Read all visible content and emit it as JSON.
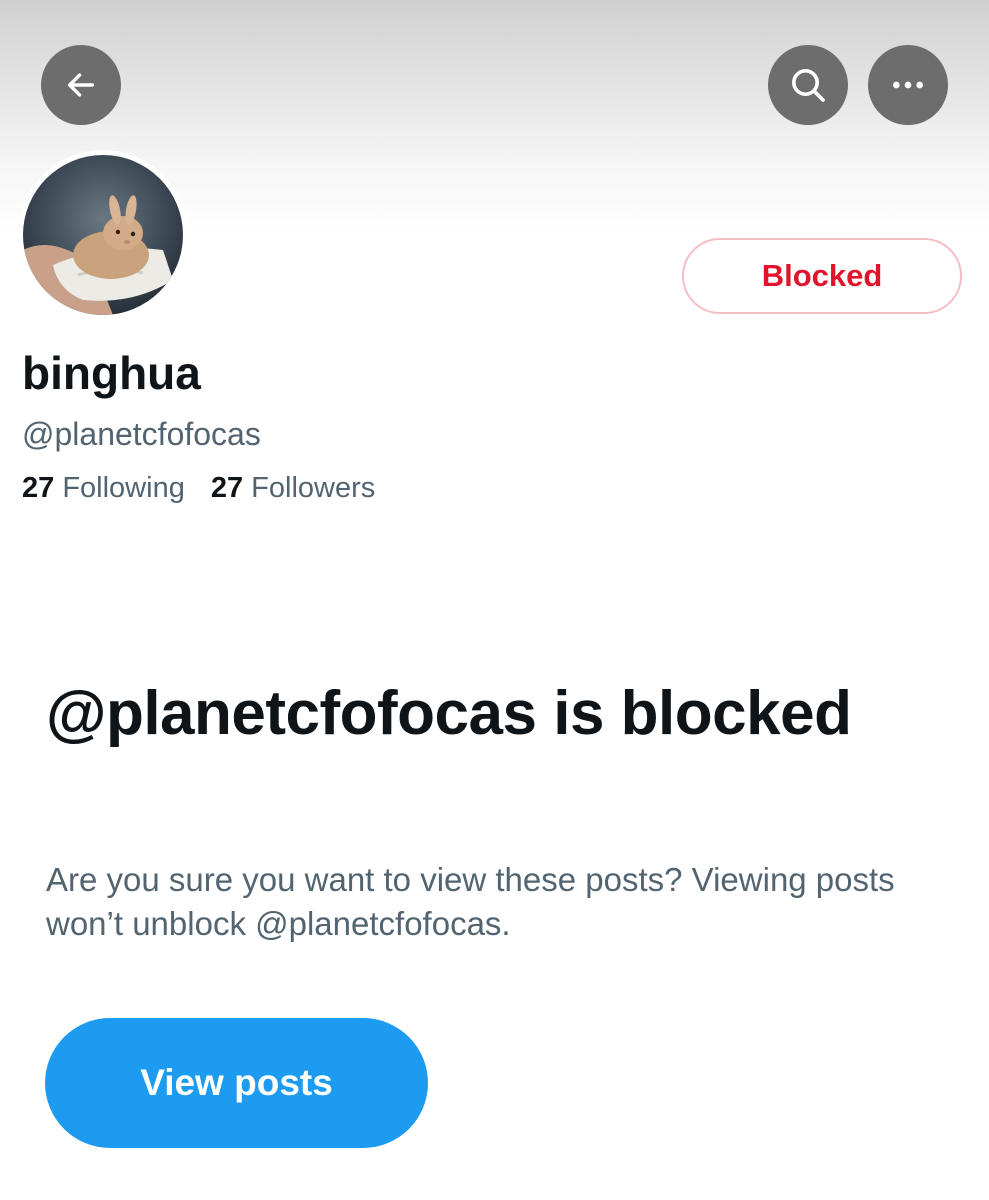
{
  "header": {
    "back_icon": "arrow-left-icon",
    "search_icon": "search-icon",
    "more_icon": "more-horizontal-icon"
  },
  "profile": {
    "avatar_desc": "avatar",
    "action_button_label": "Blocked",
    "display_name": "binghua",
    "handle": "@planetcfofocas",
    "following_count": "27",
    "following_label": "Following",
    "followers_count": "27",
    "followers_label": "Followers"
  },
  "blocked_notice": {
    "title": "@planetcfofocas is blocked",
    "description": "Are you sure you want to view these posts? Viewing posts won’t unblock @planetcfofocas.",
    "button_label": "View posts"
  },
  "colors": {
    "accent": "#1d9bf0",
    "blocked_red": "#e0142a",
    "secondary_text": "#536471",
    "primary_text": "#0f1419"
  }
}
